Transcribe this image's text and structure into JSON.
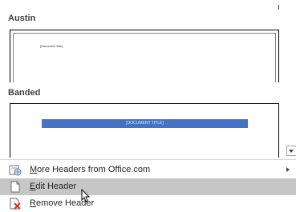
{
  "gallery": {
    "austin": {
      "section_label": "Austin",
      "thumb_text": "[Document title]"
    },
    "banded": {
      "section_label": "Banded",
      "thumb_text": "[DOCUMENT TITLE]"
    }
  },
  "menu": {
    "more_headers": {
      "accel": "M",
      "rest": "ore Headers from Office.com",
      "icon": "office-online-icon"
    },
    "edit_header": {
      "accel": "E",
      "rest": "dit Header",
      "icon": "page-icon"
    },
    "remove_header": {
      "accel": "R",
      "rest": "emove Header",
      "icon": "page-remove-icon"
    }
  },
  "colors": {
    "band": "#4472c4",
    "hover": "#c6c6c6",
    "remove_x": "#e0301e"
  }
}
